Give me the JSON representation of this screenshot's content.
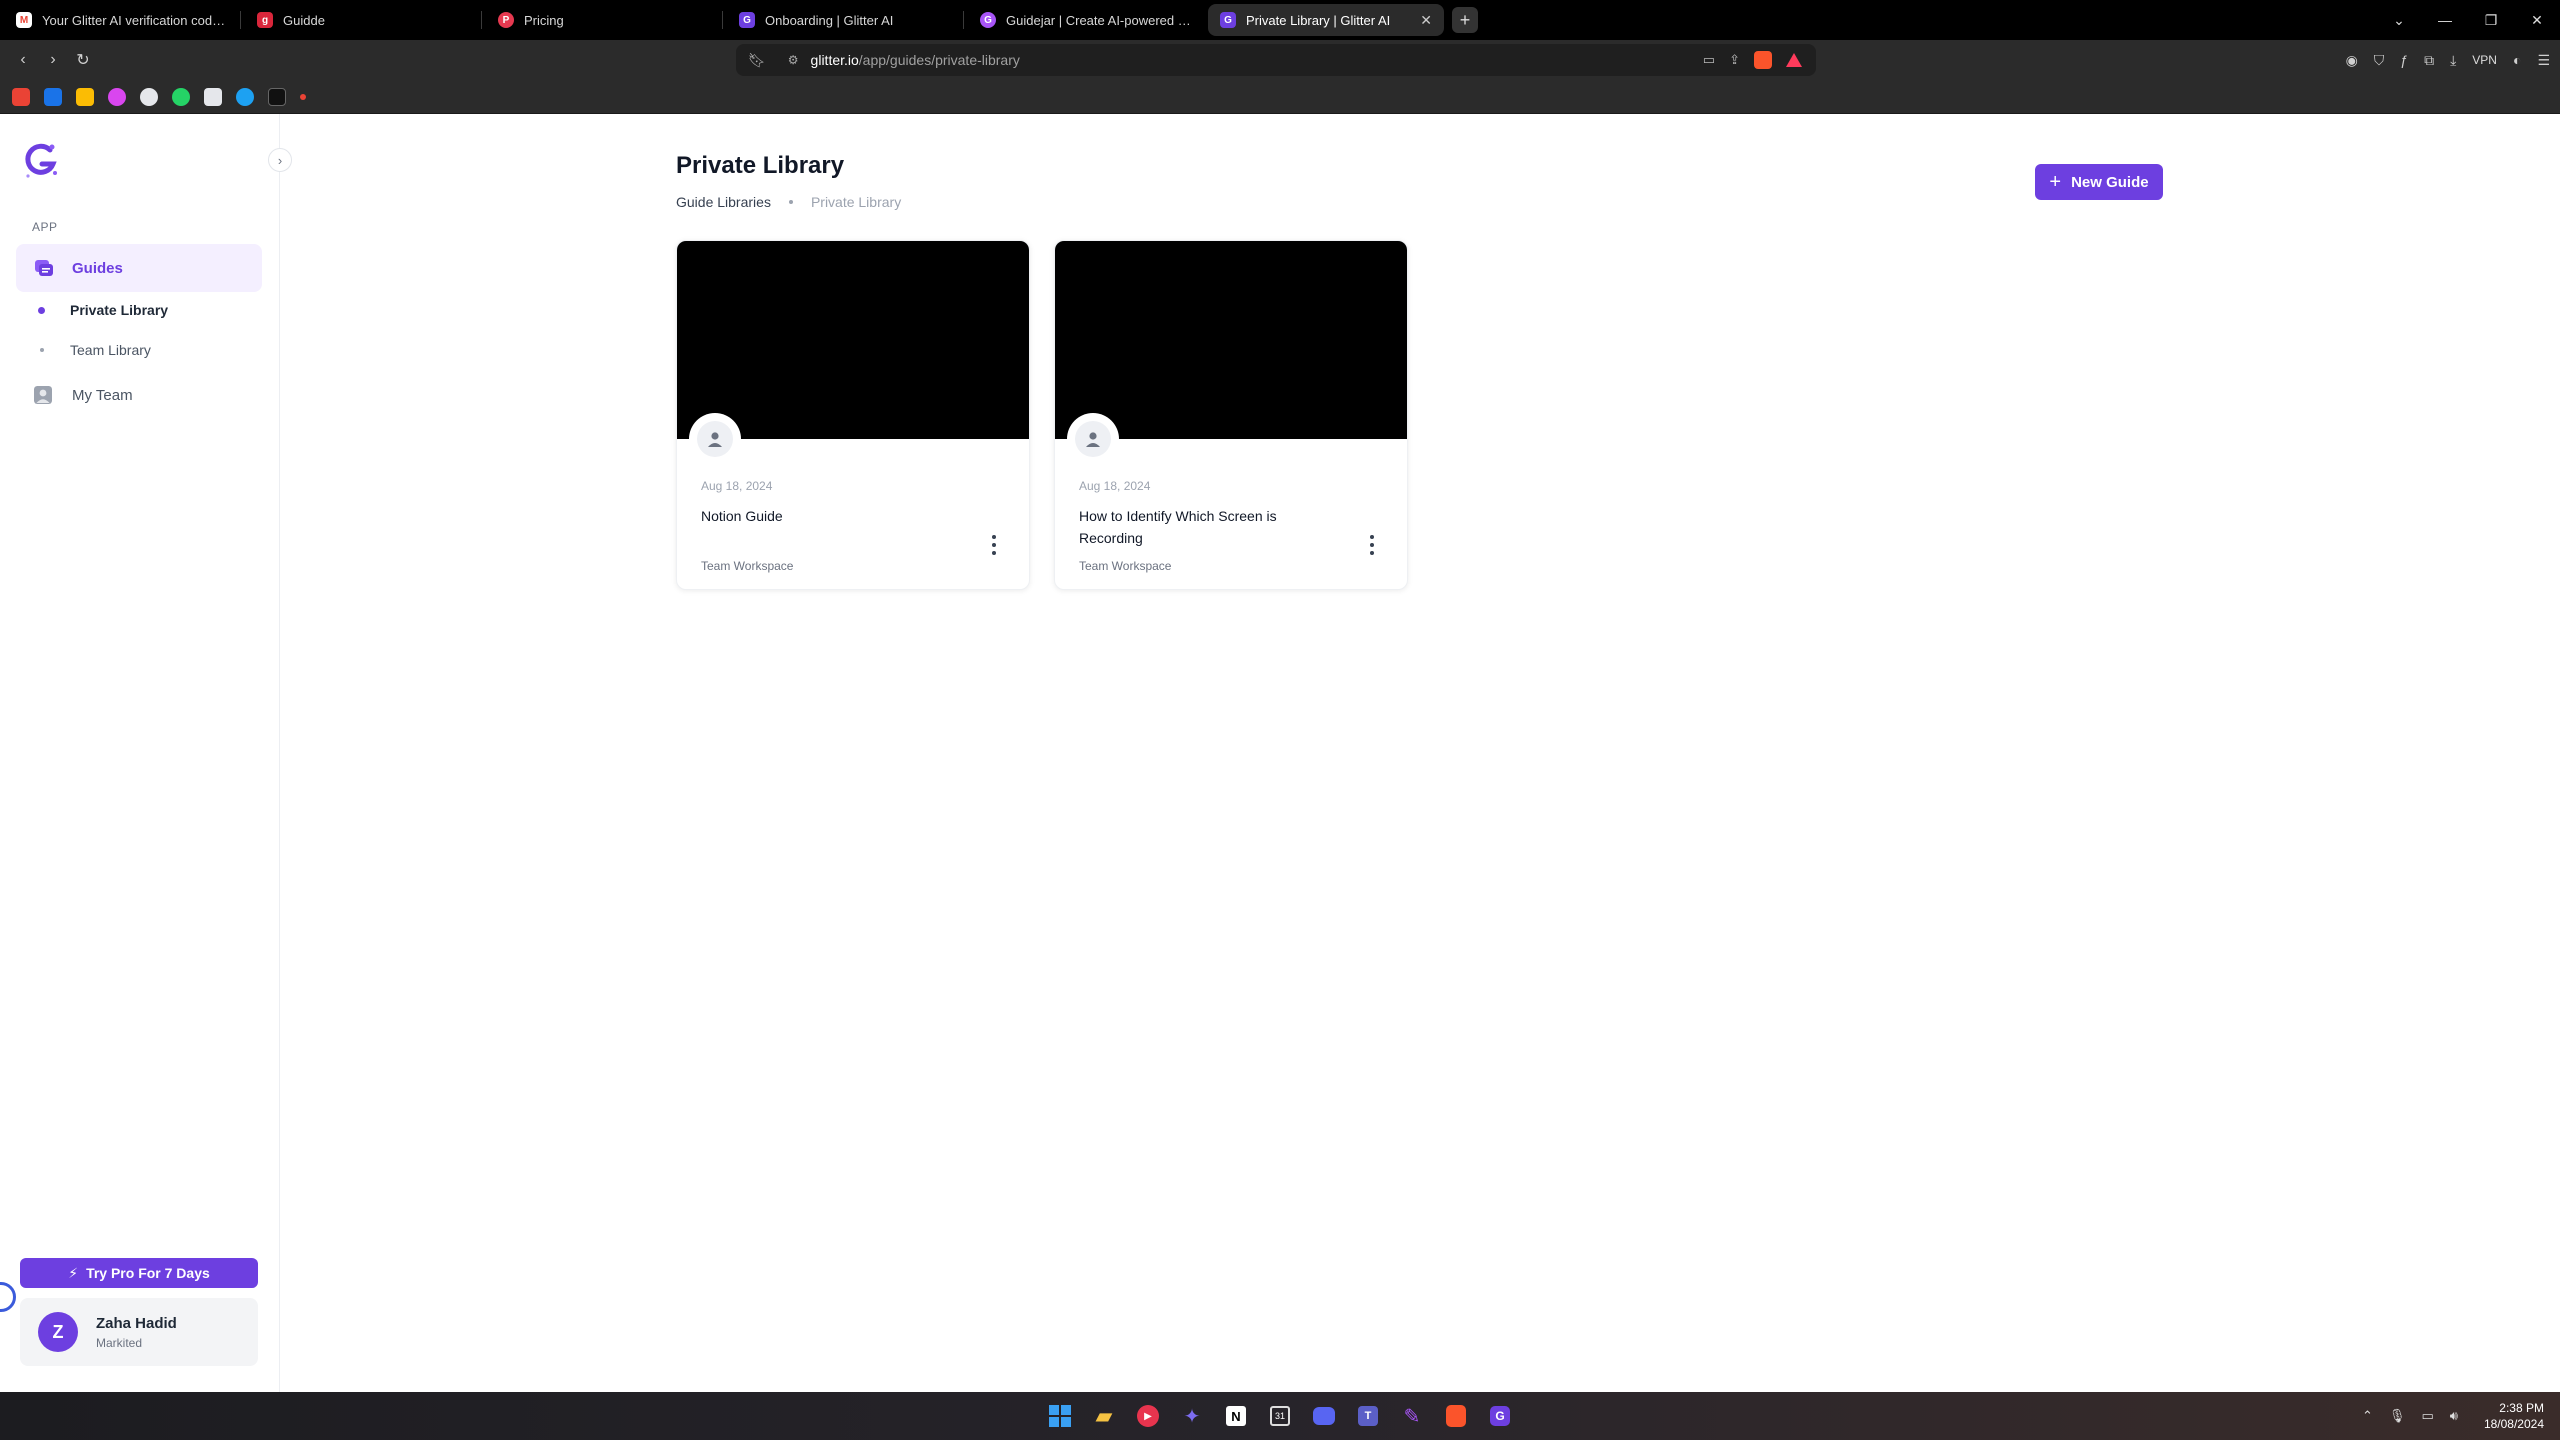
{
  "browser": {
    "tabs": [
      {
        "title": "Your Glitter AI verification code - pa",
        "icon": "gmail-icon",
        "color": "#ea4335"
      },
      {
        "title": "Guidde",
        "icon": "guidde-icon",
        "color": "#d9263b"
      },
      {
        "title": "Pricing",
        "icon": "pricing-icon",
        "color": "#e63950"
      },
      {
        "title": "Onboarding | Glitter AI",
        "icon": "glitter-icon",
        "color": "#6d3fe0"
      },
      {
        "title": "Guidejar | Create AI-powered step-b",
        "icon": "guidejar-icon",
        "color": "#a855f7"
      },
      {
        "title": "Private Library | Glitter AI",
        "icon": "glitter-icon",
        "color": "#6d3fe0",
        "active": true
      }
    ],
    "url_host": "glitter.io",
    "url_path": "/app/guides/private-library",
    "vpn_label": "VPN"
  },
  "sidebar": {
    "section_label": "APP",
    "guides_label": "Guides",
    "private_library_label": "Private Library",
    "team_library_label": "Team Library",
    "my_team_label": "My Team",
    "pro_button_label": "Try Pro For 7 Days",
    "user": {
      "initial": "Z",
      "name": "Zaha Hadid",
      "subtitle": "Markited"
    }
  },
  "main": {
    "title": "Private Library",
    "breadcrumb": [
      "Guide Libraries",
      "Private Library"
    ],
    "new_guide_label": "New Guide",
    "cards": [
      {
        "date": "Aug 18, 2024",
        "title": "Notion Guide",
        "workspace": "Team Workspace"
      },
      {
        "date": "Aug 18, 2024",
        "title": "How to Identify Which Screen is Recording",
        "workspace": "Team Workspace"
      }
    ]
  },
  "taskbar": {
    "time": "2:38 PM",
    "date": "18/08/2024"
  },
  "colors": {
    "accent": "#6d3fe0",
    "accent_light": "#f4efff"
  }
}
